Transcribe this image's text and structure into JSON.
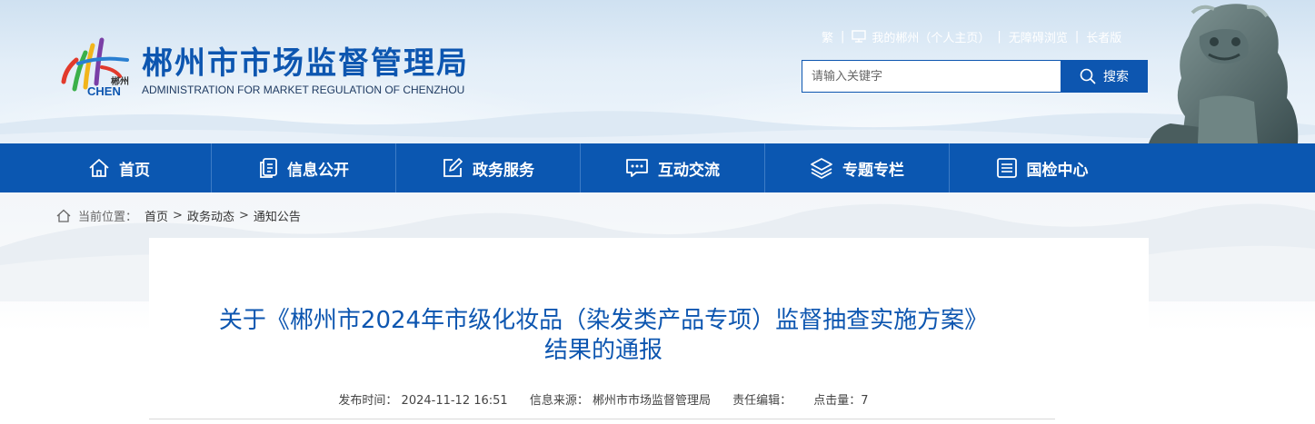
{
  "header": {
    "title": "郴州市市场监督管理局",
    "subtitle": "ADMINISTRATION FOR MARKET REGULATION OF CHENZHOU",
    "logo_text_cn": "郴州",
    "logo_text_en": "CHEN",
    "top_links": [
      "繁",
      "我的郴州（个人主页）",
      "无障碍浏览",
      "长者版"
    ],
    "search": {
      "placeholder": "请输入关键字",
      "button_label": "搜索"
    }
  },
  "nav": [
    {
      "label": "首页",
      "icon": "home-icon"
    },
    {
      "label": "信息公开",
      "icon": "documents-icon"
    },
    {
      "label": "政务服务",
      "icon": "edit-icon"
    },
    {
      "label": "互动交流",
      "icon": "chat-icon"
    },
    {
      "label": "专题专栏",
      "icon": "layers-icon"
    },
    {
      "label": "国检中心",
      "icon": "list-icon"
    }
  ],
  "breadcrumb": {
    "label": "当前位置：",
    "items": [
      "首页",
      "政务动态",
      "通知公告"
    ],
    "separator": ">"
  },
  "article": {
    "title_line1": "关于《郴州市2024年市级化妆品（染发类产品专项）监督抽查实施方案》",
    "title_line2": "结果的通报",
    "meta": {
      "published": "发布时间： 2024-11-12 16:51",
      "source": "信息来源： 郴州市市场监督管理局",
      "editor": "责任编辑：",
      "views": "点击量：7"
    }
  },
  "colors": {
    "brand_blue": "#0d56b0",
    "nav_blue": "#0b57b1"
  }
}
